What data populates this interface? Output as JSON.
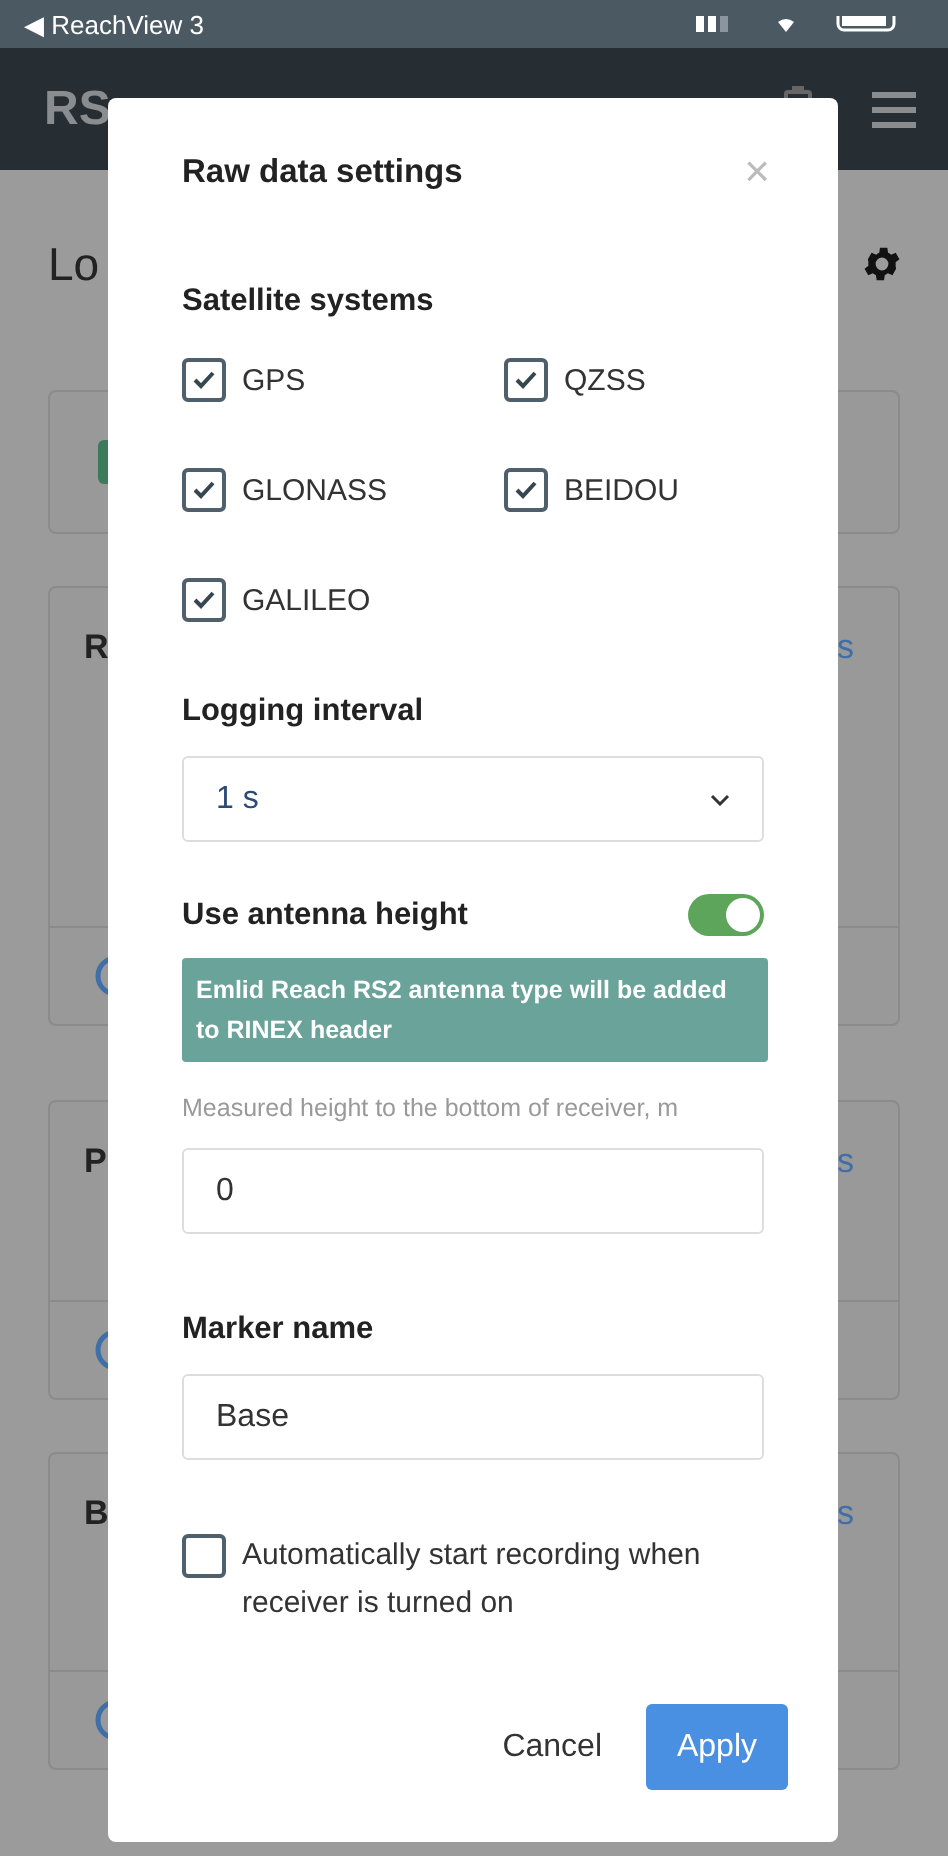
{
  "status_bar": {
    "back": "◀",
    "app": "ReachView 3"
  },
  "header": {
    "title": "RS"
  },
  "page": {
    "title": "Lo",
    "cards": [
      {
        "kind": "status"
      },
      {
        "kind": "log",
        "title": "R",
        "link": "s"
      },
      {
        "kind": "log",
        "title": "P",
        "link": "s"
      },
      {
        "kind": "log",
        "title": "B",
        "link": "s"
      }
    ]
  },
  "dialog": {
    "title": "Raw data settings",
    "close": "×",
    "satellite_label": "Satellite systems",
    "systems": [
      {
        "label": "GPS",
        "checked": true
      },
      {
        "label": "QZSS",
        "checked": true
      },
      {
        "label": "GLONASS",
        "checked": true
      },
      {
        "label": "BEIDOU",
        "checked": true
      },
      {
        "label": "GALILEO",
        "checked": true
      }
    ],
    "interval_label": "Logging interval",
    "interval_value": "1 s",
    "antenna_label": "Use antenna height",
    "antenna_on": true,
    "antenna_note": "Emlid Reach RS2 antenna type will be added to RINEX header",
    "height_hint": "Measured height to the bottom of receiver, m",
    "height_value": "0",
    "marker_label": "Marker name",
    "marker_value": "Base",
    "autostart": {
      "label": "Automatically start recording when receiver is turned on",
      "checked": false
    },
    "buttons": [
      {
        "label": "Cancel",
        "kind": "flat"
      },
      {
        "label": "Apply",
        "kind": "primary"
      }
    ]
  }
}
